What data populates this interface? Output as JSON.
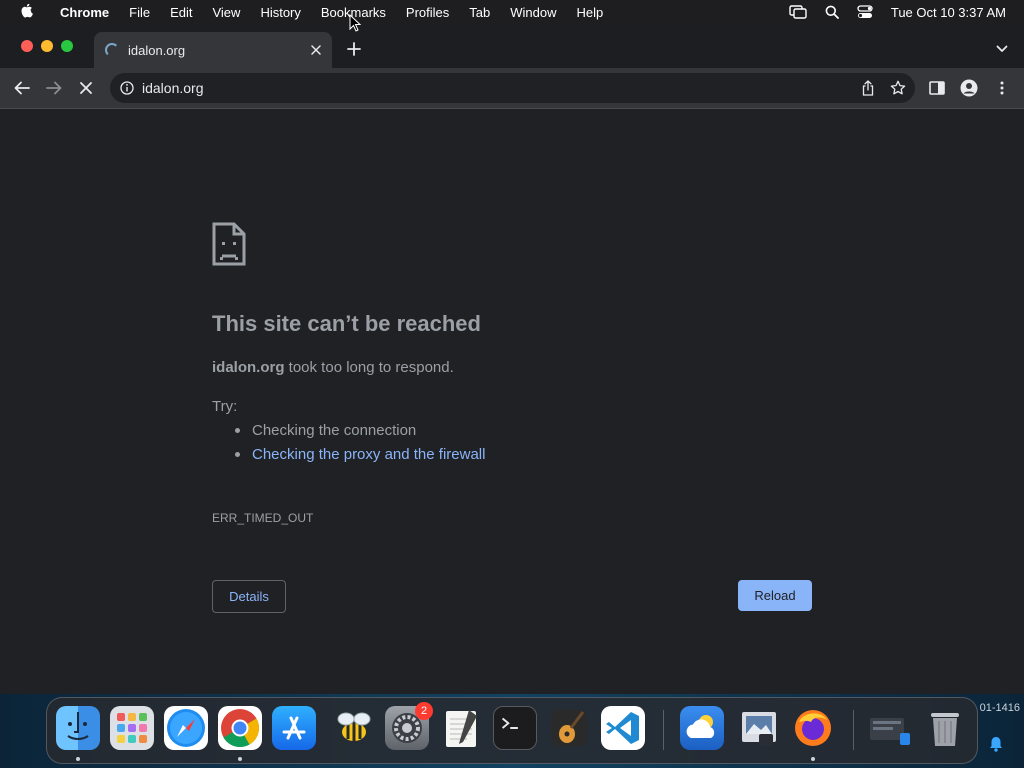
{
  "menubar": {
    "app_name": "Chrome",
    "items": [
      "File",
      "Edit",
      "View",
      "History",
      "Bookmarks",
      "Profiles",
      "Tab",
      "Window",
      "Help"
    ],
    "clock": "Tue Oct 10  3:37 AM",
    "icons": [
      "apple-icon",
      "screen-mirroring-icon",
      "spotlight-search-icon",
      "control-center-icon"
    ]
  },
  "tab": {
    "title": "idalon.org",
    "loading": true
  },
  "toolbar": {
    "url": "idalon.org"
  },
  "error_page": {
    "title": "This site can’t be reached",
    "host": "idalon.org",
    "message_suffix": " took too long to respond.",
    "try_label": "Try:",
    "suggestions": [
      "Checking the connection",
      "Checking the proxy and the firewall"
    ],
    "error_code": "ERR_TIMED_OUT",
    "details_label": "Details",
    "reload_label": "Reload"
  },
  "desktop": {
    "visible_text": "01-1416"
  },
  "dock": {
    "apps": [
      "Finder",
      "Launchpad",
      "Safari",
      "Google Chrome",
      "App Store",
      "Bee app",
      "System Settings",
      "TextEdit",
      "Terminal",
      "GarageBand",
      "Visual Studio Code",
      "Weather",
      "Preview",
      "Firefox",
      "Downloads stack",
      "Trash"
    ],
    "system_settings_badge": "2"
  },
  "colors": {
    "page_bg": "#202124",
    "tab_active": "#35363a",
    "link_blue": "#8ab4f8",
    "muted_text": "#9aa0a6"
  }
}
